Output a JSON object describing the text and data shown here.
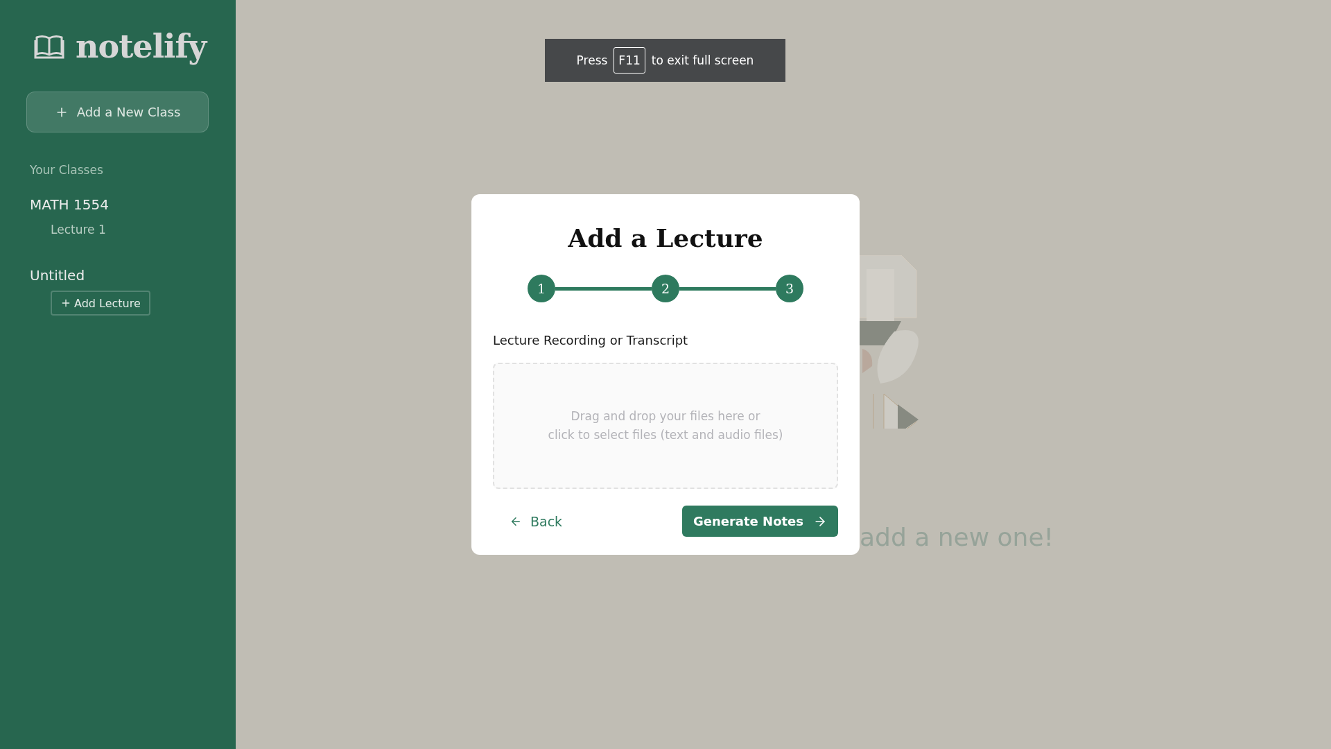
{
  "sidebar": {
    "logo": "notelify",
    "add_class_button": "Add a New Class",
    "section_title": "Your Classes",
    "classes": [
      {
        "name": "MATH 1554",
        "lectures": [
          "Lecture 1"
        ]
      },
      {
        "name": "Untitled",
        "add_lecture_button": "Add Lecture"
      }
    ]
  },
  "empty_state": {
    "message": "add a new one!"
  },
  "fullscreen_toast": {
    "before": "Press",
    "key": "F11",
    "after": "to exit full screen"
  },
  "modal": {
    "title": "Add a Lecture",
    "steps": [
      "1",
      "2",
      "3"
    ],
    "field_label": "Lecture Recording or Transcript",
    "dropzone": [
      "Drag and drop your files here or",
      "click to select files (text and audio files)"
    ],
    "back_button": "Back",
    "next_button": "Generate Notes"
  }
}
